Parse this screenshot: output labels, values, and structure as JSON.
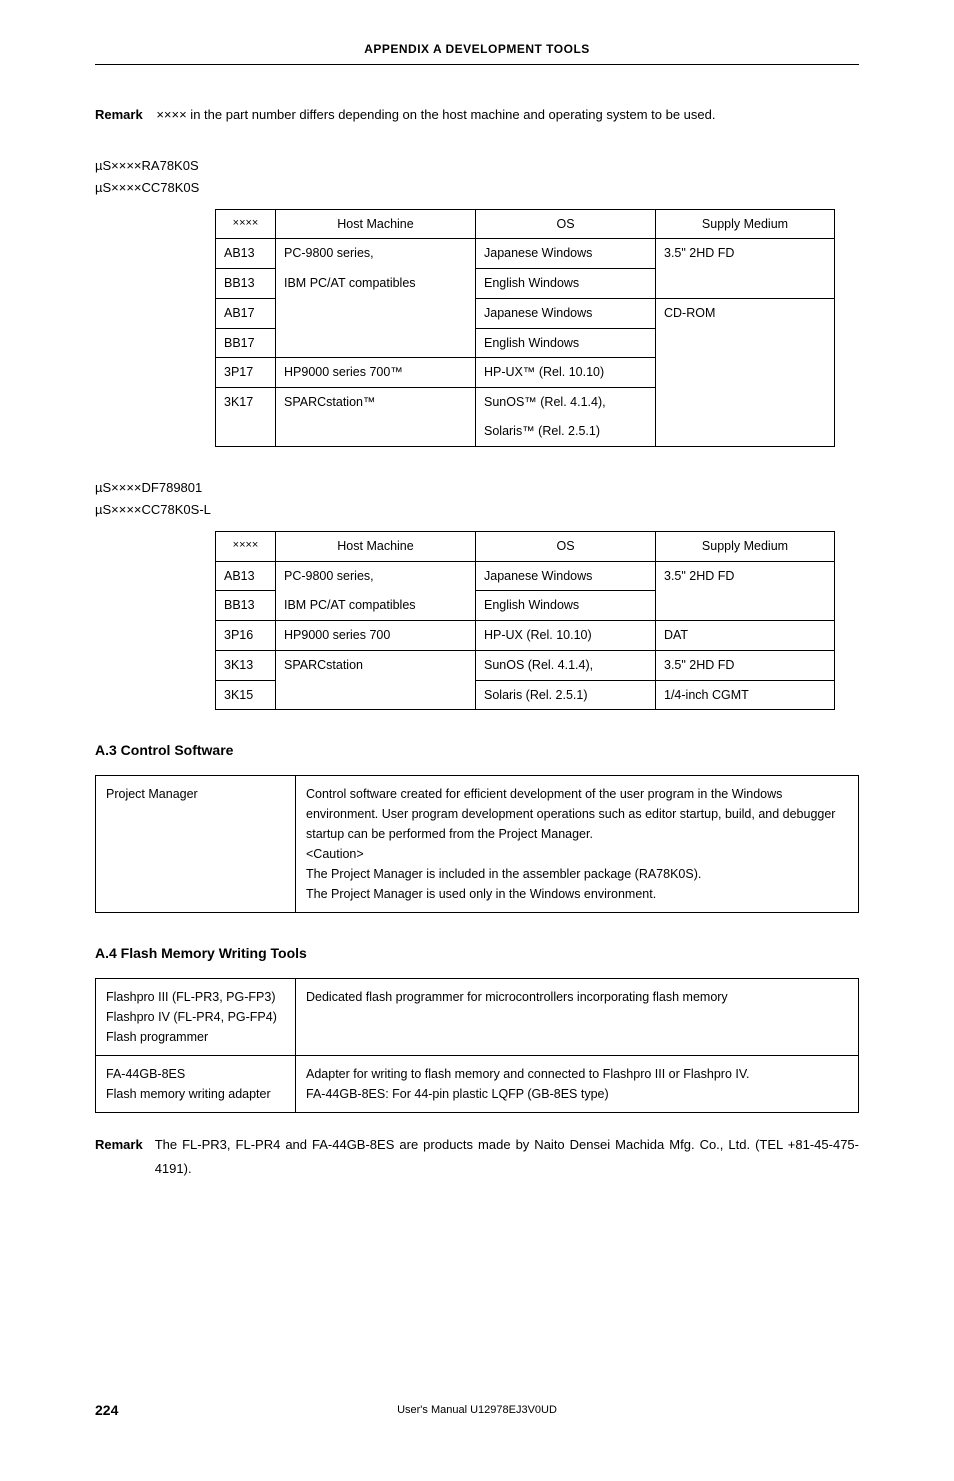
{
  "header": "APPENDIX A   DEVELOPMENT TOOLS",
  "remark1": {
    "label": "Remark",
    "text": "×××× in the part number differs depending on the host machine and operating system to be used."
  },
  "codesA": [
    "µS××××RA78K0S",
    "µS××××CC78K0S"
  ],
  "table1": {
    "headers": [
      "××××",
      "Host Machine",
      "OS",
      "Supply Medium"
    ],
    "rows": [
      {
        "c0": "AB13",
        "c1": "PC-9800 series,",
        "c2": "Japanese Windows",
        "c3": "3.5\" 2HD FD"
      },
      {
        "c0": "BB13",
        "c1": "IBM PC/AT compatibles",
        "c2": "English Windows",
        "c3": ""
      },
      {
        "c0": "AB17",
        "c1": "",
        "c2": "Japanese Windows",
        "c3": "CD-ROM"
      },
      {
        "c0": "BB17",
        "c1": "",
        "c2": "English Windows",
        "c3": ""
      },
      {
        "c0": "3P17",
        "c1": "HP9000 series 700™",
        "c2": "HP-UX™ (Rel. 10.10)",
        "c3": ""
      },
      {
        "c0": "3K17",
        "c1": "SPARCstation™",
        "c2": "SunOS™ (Rel. 4.1.4),",
        "c3": ""
      },
      {
        "c0": "",
        "c1": "",
        "c2": "Solaris™ (Rel. 2.5.1)",
        "c3": ""
      }
    ]
  },
  "codesB": [
    "µS××××DF789801",
    "µS××××CC78K0S-L"
  ],
  "table2": {
    "headers": [
      "××××",
      "Host Machine",
      "OS",
      "Supply Medium"
    ],
    "rows": [
      {
        "c0": "AB13",
        "c1": "PC-9800 series,",
        "c2": "Japanese Windows",
        "c3": "3.5\" 2HD FD"
      },
      {
        "c0": "BB13",
        "c1": "IBM PC/AT compatibles",
        "c2": "English Windows",
        "c3": ""
      },
      {
        "c0": "3P16",
        "c1": "HP9000 series 700",
        "c2": "HP-UX (Rel. 10.10)",
        "c3": "DAT"
      },
      {
        "c0": "3K13",
        "c1": "SPARCstation",
        "c2": "SunOS (Rel. 4.1.4),",
        "c3": "3.5\" 2HD FD"
      },
      {
        "c0": "3K15",
        "c1": "",
        "c2": "Solaris (Rel. 2.5.1)",
        "c3": "1/4-inch CGMT"
      }
    ]
  },
  "sectionA3": {
    "title": "A.3  Control Software",
    "row": {
      "name": "Project Manager",
      "desc": "Control software created for efficient development of the user program in the Windows environment.  User program development operations such as editor startup, build, and debugger startup can be performed from the Project Manager.\n<Caution>\nThe Project Manager is included in the assembler package (RA78K0S).\nThe Project Manager is used only in the Windows environment."
    }
  },
  "sectionA4": {
    "title": "A.4  Flash Memory Writing Tools",
    "rows": [
      {
        "name": "Flashpro III (FL-PR3, PG-FP3)\nFlashpro IV (FL-PR4, PG-FP4)\nFlash programmer",
        "desc": "Dedicated flash programmer for microcontrollers incorporating flash memory"
      },
      {
        "name": "FA-44GB-8ES\nFlash memory writing adapter",
        "desc": "Adapter for writing to flash memory and connected to Flashpro III or Flashpro IV.\nFA-44GB-8ES: For 44-pin plastic LQFP (GB-8ES type)"
      }
    ]
  },
  "remark2": {
    "label": "Remark",
    "text": "The FL-PR3, FL-PR4 and FA-44GB-8ES are products made by Naito Densei Machida Mfg. Co., Ltd. (TEL +81-45-475-4191)."
  },
  "footer": {
    "page": "224",
    "center": "User's Manual  U12978EJ3V0UD"
  }
}
